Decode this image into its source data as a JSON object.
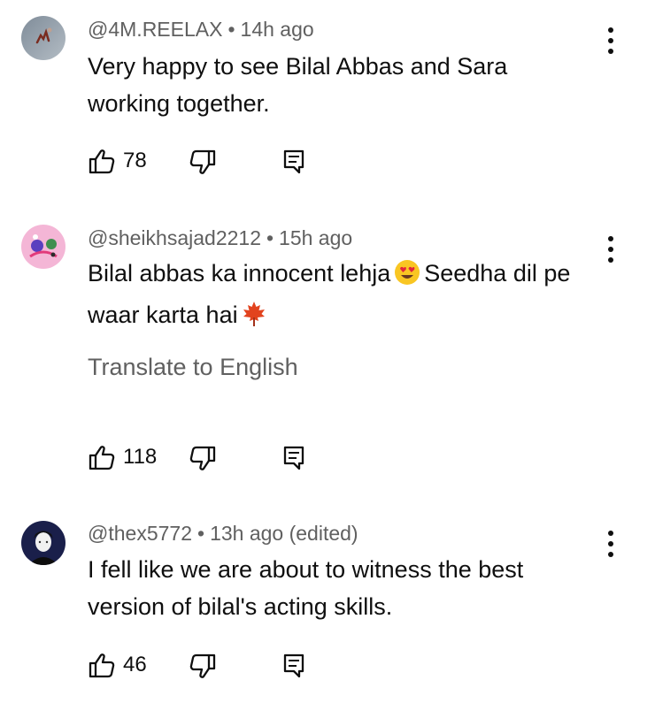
{
  "comments": [
    {
      "username": "@4M.REELAX",
      "separator": "•",
      "time": "14h ago",
      "text": "Very happy to see Bilal Abbas and Sara working together.",
      "likes": "78"
    },
    {
      "username": "@sheikhsajad2212",
      "separator": "•",
      "time": "15h ago",
      "text_part1": "Bilal abbas ka innocent lehja",
      "text_part2": "Seedha dil pe waar karta hai",
      "translate": "Translate to English",
      "likes": "118"
    },
    {
      "username": "@thex5772",
      "separator": "•",
      "time": "13h ago (edited)",
      "text": "I fell like we are about to witness the best version of bilal's acting skills.",
      "likes": "46"
    }
  ],
  "icons": {
    "like": "thumbs-up-icon",
    "dislike": "thumbs-down-icon",
    "reply": "reply-comment-icon",
    "more": "vertical-ellipsis-icon"
  },
  "colors": {
    "text": "#0f0f0f",
    "secondary": "#606060"
  }
}
